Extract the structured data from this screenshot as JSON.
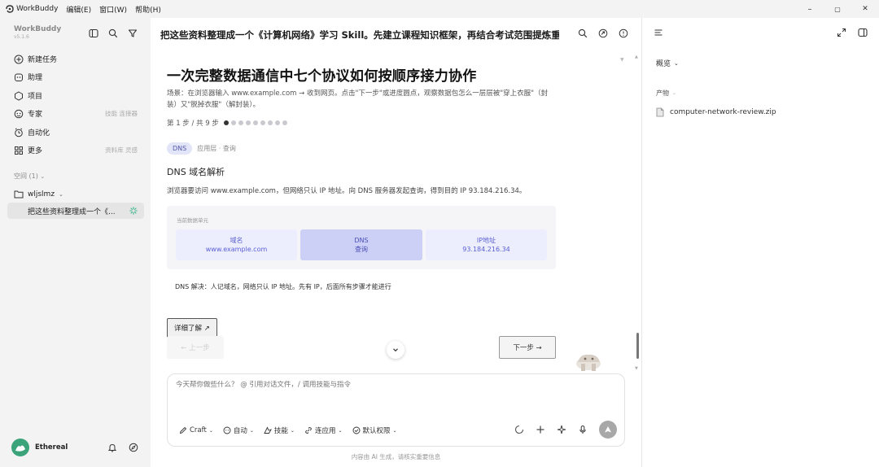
{
  "app": {
    "name": "WorkBuddy",
    "version": "v5.1.6",
    "menu": [
      "编辑(E)",
      "窗口(W)",
      "帮助(H)"
    ]
  },
  "window_controls": [
    "–",
    "▢",
    "✕"
  ],
  "sidebar": {
    "items": [
      {
        "label": "新建任务",
        "icon": "plus-circle-icon",
        "hint": ""
      },
      {
        "label": "助理",
        "icon": "assistant-icon",
        "hint": ""
      },
      {
        "label": "项目",
        "icon": "project-icon",
        "hint": ""
      },
      {
        "label": "专家",
        "icon": "expert-icon",
        "hint": "技能 连接器"
      },
      {
        "label": "自动化",
        "icon": "automation-icon",
        "hint": ""
      },
      {
        "label": "更多",
        "icon": "grid-icon",
        "hint": "资料库 灵感"
      }
    ],
    "spaces_label": "空间 (1)",
    "workspace": "wljslmz",
    "active_task": "把这些资料整理成一个《..."
  },
  "user": {
    "name": "Ethereal"
  },
  "main": {
    "header_title": "把这些资料整理成一个《计算机网络》学习 Skill。先建立课程知识框架，再结合考试范围提炼重...",
    "heading": "一次完整数据通信中七个协议如何按顺序接力协作",
    "scene": "场景：在浏览器输入 www.example.com → 收到网页。点击\"下一步\"或进度圆点，观察数据包怎么一层层被\"穿上衣服\"（封装）又\"脱掉衣服\"（解封装）。",
    "step_text": "第 1 步 / 共 9 步",
    "step_current": 1,
    "step_total": 9,
    "tag": "DNS",
    "layer": "应用层 · 查询",
    "section_title": "DNS 域名解析",
    "description": "浏览器要访问 www.example.com，但网络只认 IP 地址。向 DNS 服务器发起查询，得到目的 IP 93.184.216.34。",
    "data_unit_label": "当前数据单元",
    "cells": [
      {
        "title": "域名",
        "value": "www.example.com"
      },
      {
        "title": "DNS",
        "value": "查询"
      },
      {
        "title": "IP地址",
        "value": "93.184.216.34"
      }
    ],
    "note": "DNS 解决：人记域名，网络只认 IP 地址。先有 IP，后面所有步骤才能进行",
    "more_button": "详细了解 ↗",
    "prev_button": "← 上一步",
    "next_button": "下一步 →"
  },
  "composer": {
    "placeholder": "今天帮你做些什么？ @ 引用对话文件，/ 调用技能与指令",
    "tools": [
      "Craft",
      "自动",
      "技能",
      "连应用",
      "默认权限"
    ]
  },
  "footer": "内容由 AI 生成，请核实重要信息",
  "right_panel": {
    "overview": "概览",
    "products_label": "产物",
    "file": "computer-network-review.zip"
  }
}
